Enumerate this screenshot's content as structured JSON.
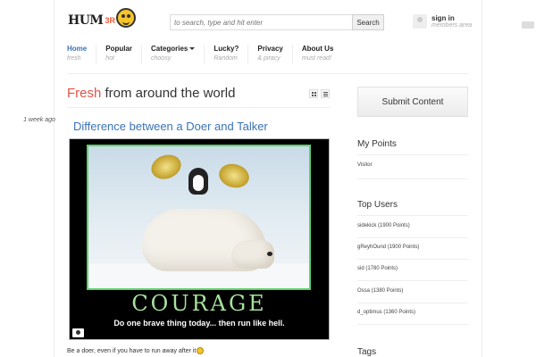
{
  "header": {
    "logo_text": "HUM",
    "logo_tag": "3R",
    "search_placeholder": "to search, type and hit enter",
    "search_button": "Search",
    "signin_title": "sign in",
    "signin_sub": "members area"
  },
  "nav": [
    {
      "label": "Home",
      "sub": "fresh"
    },
    {
      "label": "Popular",
      "sub": "hot"
    },
    {
      "label": "Categories",
      "sub": "choosy"
    },
    {
      "label": "Lucky?",
      "sub": "Random"
    },
    {
      "label": "Privacy",
      "sub": "& piracy"
    },
    {
      "label": "About Us",
      "sub": "must read!"
    }
  ],
  "main": {
    "title_accent": "Fresh",
    "title_rest": " from around the world",
    "time_badge": "1 week ago",
    "post_title": "Difference between a Doer and Talker",
    "poster_word": "COURAGE",
    "poster_sub": "Do one brave thing today... then run like hell.",
    "caption": "Be a doer, even if you have to run away after it"
  },
  "sidebar": {
    "submit_label": "Submit Content",
    "points_heading": "My Points",
    "points_value": "Visitor",
    "top_users_heading": "Top Users",
    "top_users": [
      "sidekick (1900 Points)",
      "gReyhOund (1900 Points)",
      "sid (1780 Points)",
      "Ossa (1380 Points)",
      "d_optimus (1360 Points)"
    ],
    "tags_heading": "Tags"
  },
  "colors": {
    "accent_red": "#e0534a",
    "link_blue": "#3a73b5",
    "poster_green": "#a7e29d"
  }
}
